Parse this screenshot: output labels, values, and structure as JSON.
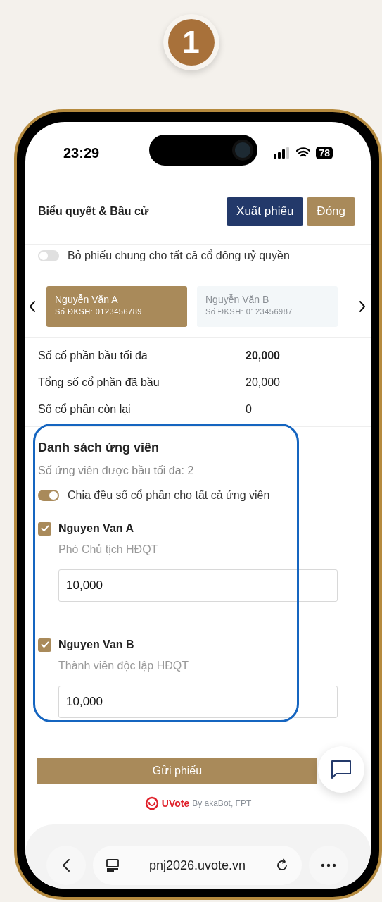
{
  "step_badge": "1",
  "status_bar": {
    "time": "23:29",
    "battery": "78"
  },
  "header": {
    "title": "Biểu quyết & Bầu cử",
    "buttons": [
      {
        "label": "Xuất phiếu",
        "kind": "primary"
      },
      {
        "label": "Đóng",
        "kind": "secondary"
      }
    ]
  },
  "proxy_toggle": {
    "label": "Bỏ phiếu chung cho tất cả cổ đông uỷ quyền",
    "on": false
  },
  "shareholders": [
    {
      "name": "Nguyễn Văn A",
      "id": "Số ĐKSH: 0123456789",
      "selected": true
    },
    {
      "name": "Nguyễn Văn B",
      "id": "Số ĐKSH: 0123456987",
      "selected": false
    }
  ],
  "stats": [
    {
      "label": "Số cổ phần bầu tối đa",
      "value": "20,000",
      "bold": true
    },
    {
      "label": "Tổng số cổ phần đã bầu",
      "value": "20,000",
      "bold": false
    },
    {
      "label": "Số cổ phần còn lại",
      "value": "0",
      "bold": false
    }
  ],
  "candidates_section": {
    "title": "Danh sách ứng viên",
    "subtitle": "Số ứng viên được bầu tối đa: 2",
    "split_toggle": {
      "label": "Chia đều số cổ phần cho tất cả ứng viên",
      "on": true
    },
    "candidates": [
      {
        "name": "Nguyen Van A",
        "role": "Phó Chủ tịch HĐQT",
        "checked": true,
        "value": "10,000"
      },
      {
        "name": "Nguyen Van B",
        "role": "Thành viên độc lập HĐQT",
        "checked": true,
        "value": "10,000"
      }
    ]
  },
  "submit_button": "Gửi phiếu",
  "footer": {
    "brand": "UVote",
    "credit": "By akaBot, FPT"
  },
  "browser": {
    "url": "pnj2026.uvote.vn"
  }
}
